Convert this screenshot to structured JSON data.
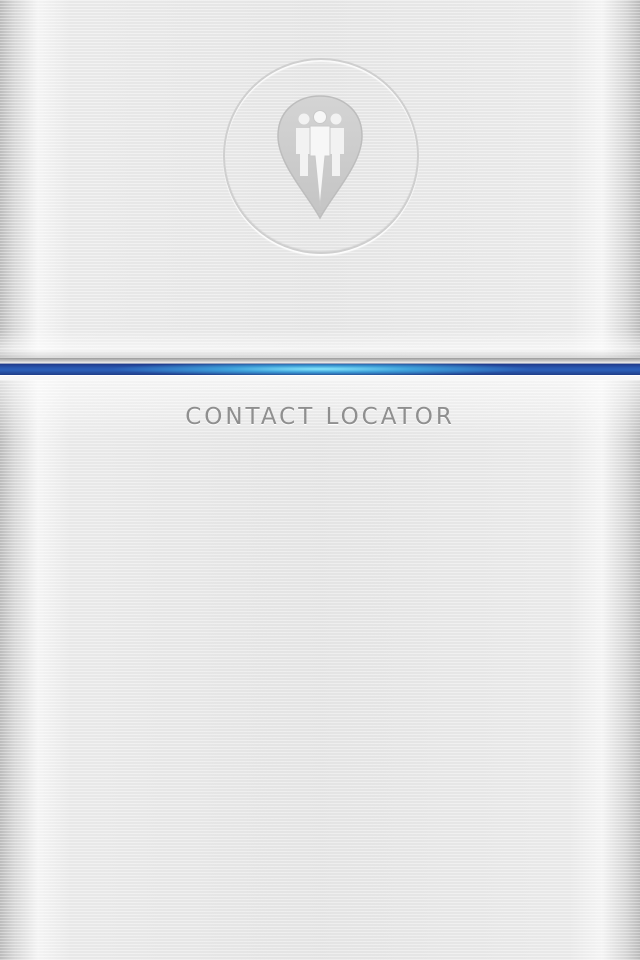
{
  "app": {
    "title": "CONTACT LOCATOR"
  },
  "logo": {
    "icon": "contacts-location-pin-icon"
  },
  "colors": {
    "divider_blue": "#2b5fb8",
    "divider_glow": "#8ceeff",
    "title_gray": "#8f8f8f",
    "logo_gray": "#c9c9c9"
  }
}
